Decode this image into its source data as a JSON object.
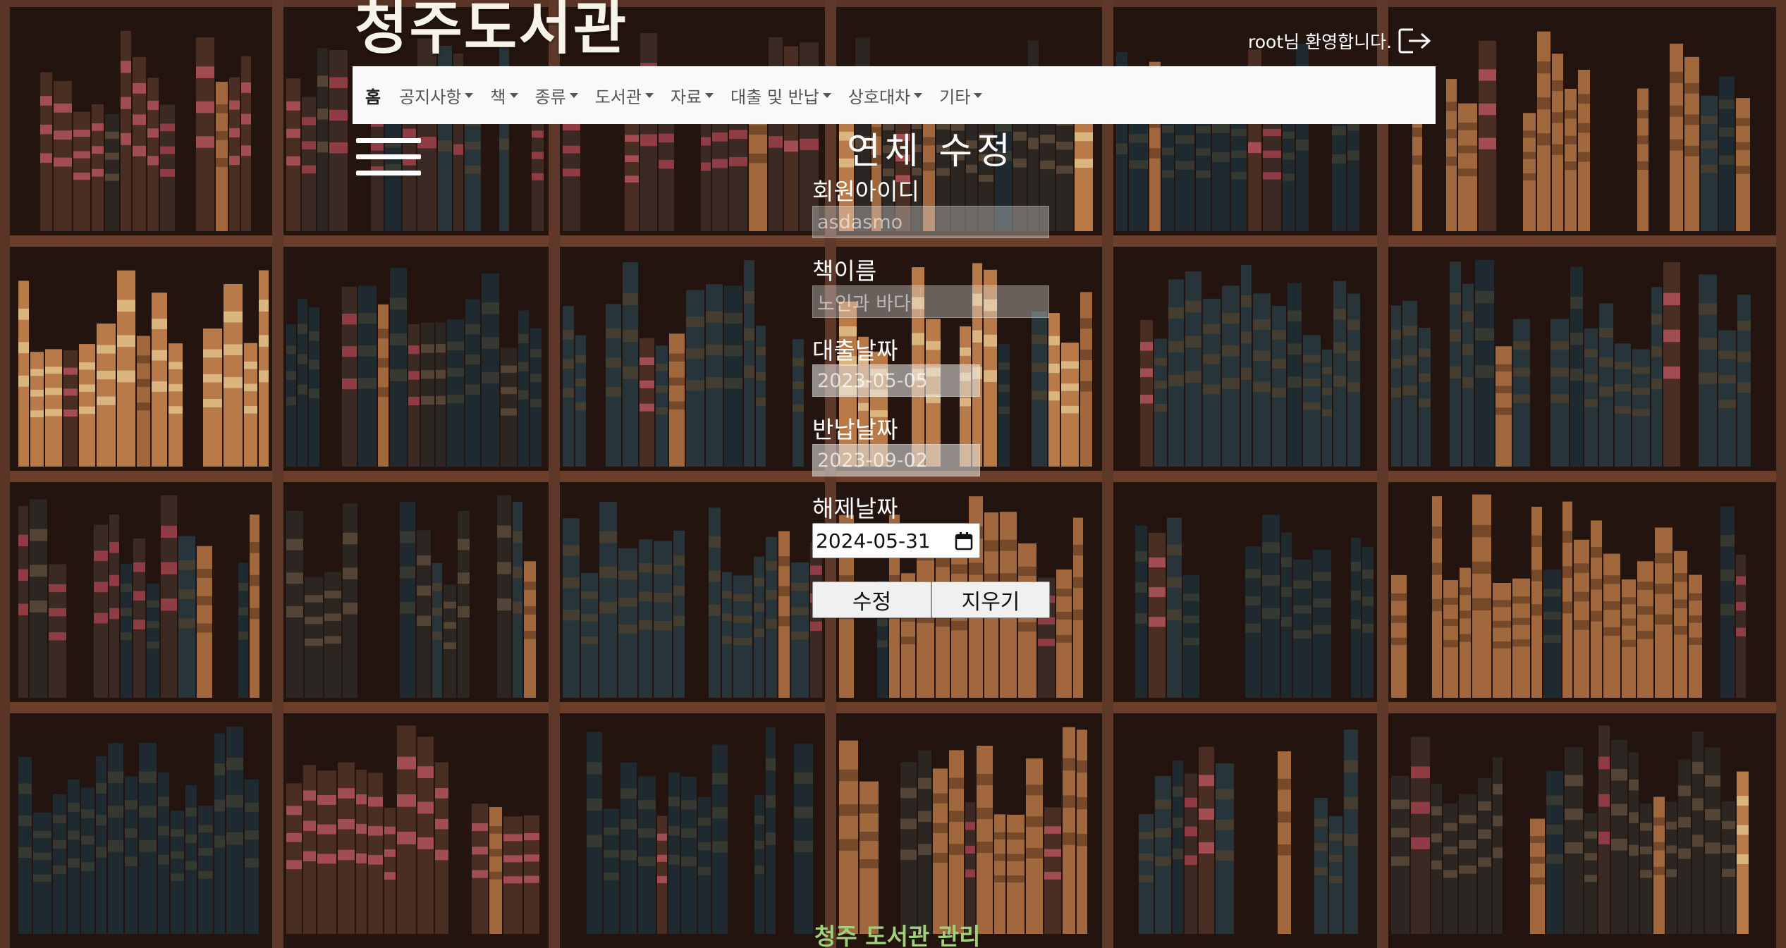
{
  "header": {
    "site_title": "청주도서관",
    "welcome_text": "root님 환영합니다.",
    "logout_icon": "logout-icon"
  },
  "nav": {
    "home": "홈",
    "items": [
      "공지사항",
      "책",
      "종류",
      "도서관",
      "자료",
      "대출 및 반납",
      "상호대차",
      "기타"
    ]
  },
  "form": {
    "title": "연체 수정",
    "member_id": {
      "label": "회원아이디",
      "value": "asdasmo"
    },
    "book_name": {
      "label": "책이름",
      "value": "노인과 바다"
    },
    "loan_date": {
      "label": "대출날짜",
      "value": "2023-05-05"
    },
    "return_date": {
      "label": "반납날짜",
      "value": "2023-09-02"
    },
    "release_date": {
      "label": "해제날짜",
      "value": "2024-05-31"
    },
    "submit_label": "수정",
    "clear_label": "지우기"
  },
  "footer": {
    "text": "청주 도서관 관리"
  },
  "colors": {
    "navbar_bg": "#f8f9fa",
    "footer_text": "#9fd07a",
    "shelf_wood": "#5a3424"
  }
}
